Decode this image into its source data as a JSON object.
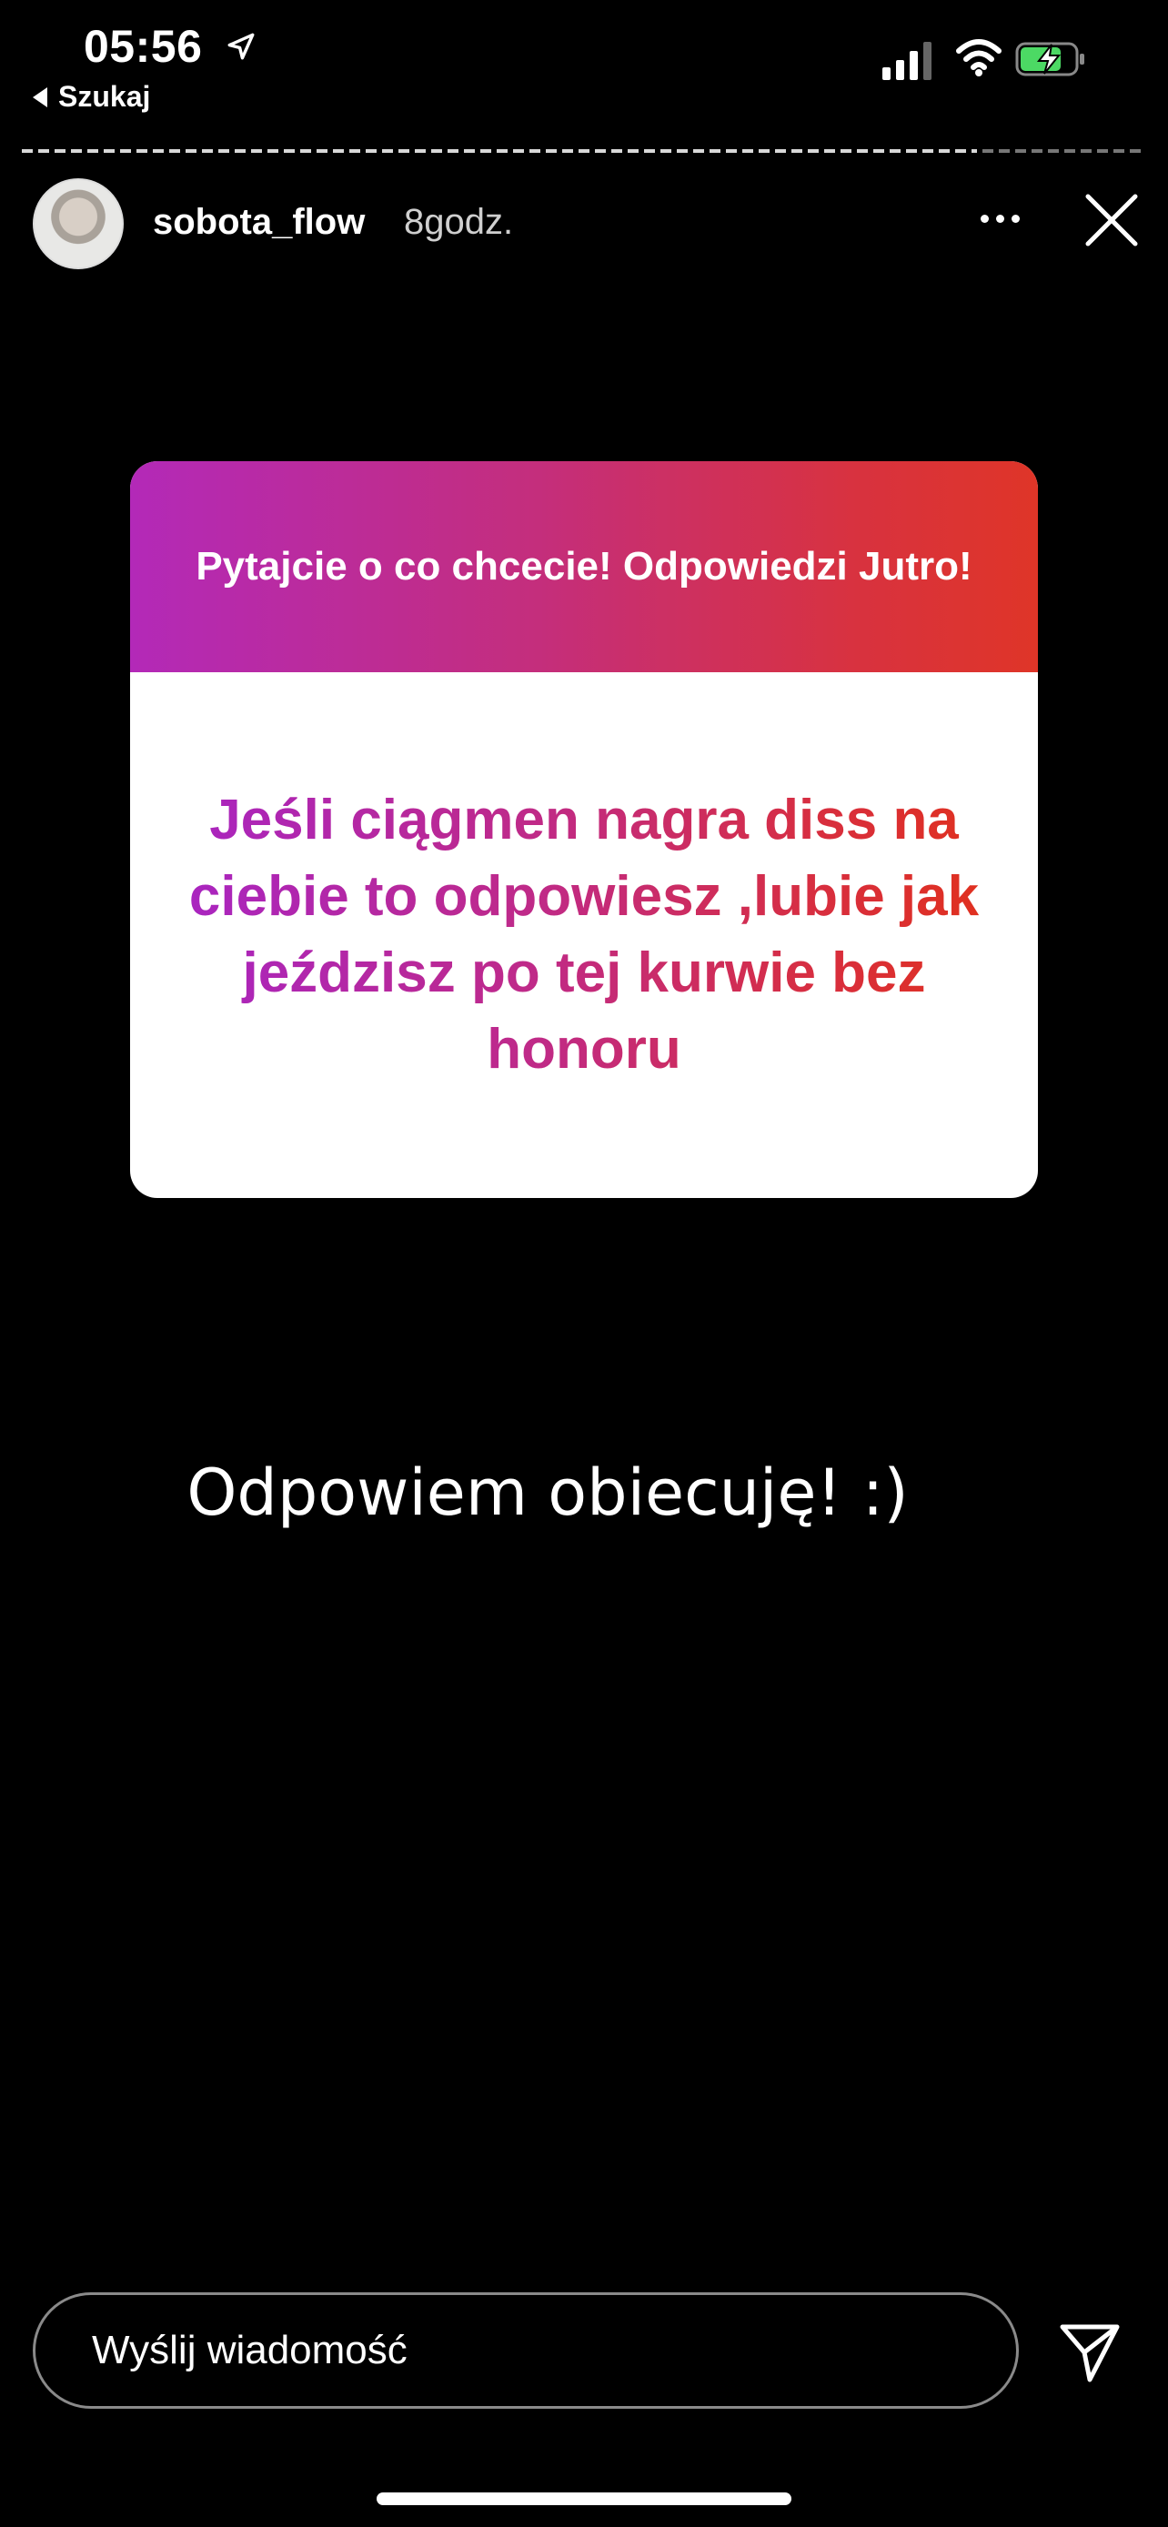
{
  "status_bar": {
    "time": "05:56",
    "back_label": "Szukaj"
  },
  "header": {
    "username": "sobota_flow",
    "time_ago": "8godz."
  },
  "question_card": {
    "prompt": "Pytajcie o co chcecie! Odpowiedzi Jutro!",
    "question": "Jeśli ciągmen nagra diss na ciebie to odpowiesz ,lubie jak jeździsz po tej kurwie bez honoru"
  },
  "caption": "Odpowiem obiecuję! :)",
  "message_bar": {
    "placeholder": "Wyślij wiadomość"
  },
  "colors": {
    "gradient_start": "#b329b8",
    "gradient_end": "#df3528",
    "battery_fill": "#4cd964"
  },
  "icons": [
    "location-arrow-icon",
    "signal-icon",
    "wifi-icon",
    "battery-charging-icon",
    "more-dots-icon",
    "close-icon",
    "send-icon"
  ]
}
